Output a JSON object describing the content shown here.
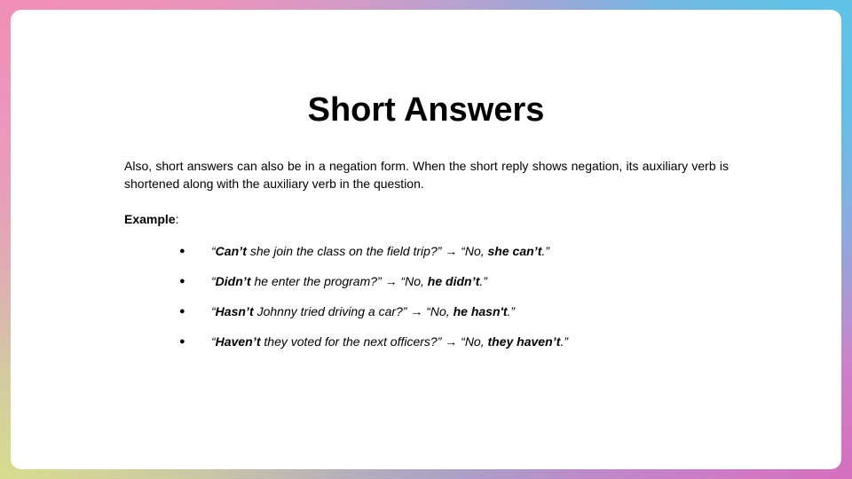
{
  "slide": {
    "title": "Short Answers",
    "intro": "Also, short answers can also be in a negation form. When the short reply shows negation, its auxiliary verb is shortened along with the auxiliary verb in the question.",
    "example_label": "Example",
    "example_colon": ":",
    "bullet_glyph": "●",
    "examples": [
      {
        "open_quote": "“",
        "q_bold": "Can’t",
        "q_rest": " she join the class on the field trip?” → “No, ",
        "a_bold": "she can’t",
        "close": ".”"
      },
      {
        "open_quote": "“",
        "q_bold": "Didn’t",
        "q_rest": " he enter the program?” → “No, ",
        "a_bold": "he didn’t",
        "close": ".”"
      },
      {
        "open_quote": "“",
        "q_bold": "Hasn’t",
        "q_rest": " Johnny tried driving a car?” → “No, ",
        "a_bold": "he hasn't",
        "close": ".”"
      },
      {
        "open_quote": "“",
        "q_bold": "Haven’t",
        "q_rest": " they voted for the next officers?” → “No, ",
        "a_bold": "they haven’t",
        "close": ".”"
      }
    ]
  }
}
